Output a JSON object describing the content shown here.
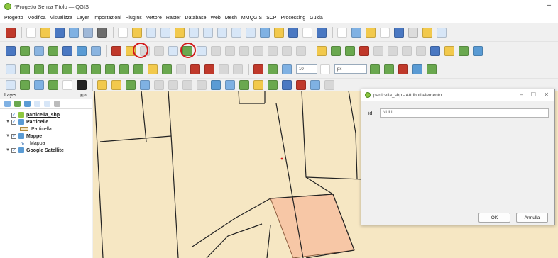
{
  "window": {
    "title": "*Progetto Senza Titolo — QGIS",
    "minimize_glyph": "–"
  },
  "menubar": {
    "items": [
      "Progetto",
      "Modifica",
      "Visualizza",
      "Layer",
      "Impostazioni",
      "Plugins",
      "Vettore",
      "Raster",
      "Database",
      "Web",
      "Mesh",
      "MMQGIS",
      "SCP",
      "Processing",
      "Guida"
    ]
  },
  "toolbar3": {
    "scale_field": "10",
    "unit_field": "px"
  },
  "layers_panel": {
    "title": "Layer",
    "layers": [
      {
        "name": "particella_shp",
        "checked": true,
        "icon": "polygon-layer-icon"
      },
      {
        "name": "Particelle",
        "checked": true,
        "icon": "group-layer-icon",
        "legend": "Particella"
      },
      {
        "name": "Mappe",
        "checked": true,
        "icon": "group-layer-icon",
        "legend": "Mappa"
      },
      {
        "name": "Google Satellite",
        "checked": true,
        "icon": "xyz-tile-layer-icon"
      }
    ]
  },
  "dialog": {
    "title": "particella_shp - Attributi elemento",
    "field_label": "id",
    "field_value": "NULL",
    "ok_label": "OK",
    "cancel_label": "Annulla"
  },
  "colors": {
    "map_fill": "#f6e7c3",
    "highlight_polygon": "#f7c7a6",
    "annotation_circle": "#d31a1a"
  }
}
